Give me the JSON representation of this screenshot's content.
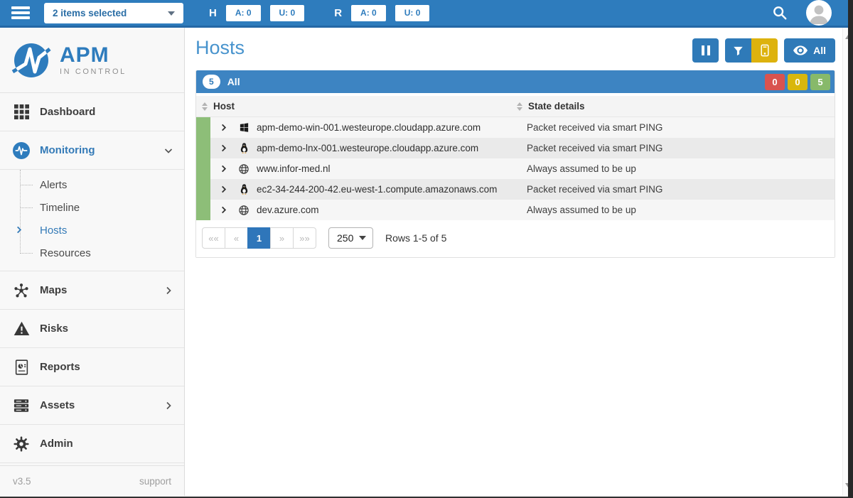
{
  "colors": {
    "topbar_blue": "#2e7cbd",
    "accent_blue": "#2f7ab8",
    "title_blue": "#4793cd",
    "filter_bar_blue": "#3d84c2",
    "yellow": "#ddb20e",
    "active_link": "#337ab7",
    "row_status_green": "#8dbe78"
  },
  "topbar": {
    "selected_filter": "2 items selected",
    "hosts_group": {
      "label": "H",
      "buttons": [
        {
          "label": "A: 0"
        },
        {
          "label": "U: 0"
        }
      ]
    },
    "resources_group": {
      "label": "R",
      "buttons": [
        {
          "label": "A: 0"
        },
        {
          "label": "U: 0"
        }
      ]
    }
  },
  "sidebar": {
    "logo": {
      "title": "APM",
      "subtitle": "IN CONTROL"
    },
    "items": [
      {
        "label": "Dashboard",
        "icon": "grid"
      },
      {
        "label": "Monitoring",
        "icon": "pulse",
        "active": true,
        "expanded": true,
        "children": [
          {
            "label": "Alerts"
          },
          {
            "label": "Timeline"
          },
          {
            "label": "Hosts",
            "active": true
          },
          {
            "label": "Resources"
          }
        ]
      },
      {
        "label": "Maps",
        "icon": "network",
        "has_children": true
      },
      {
        "label": "Risks",
        "icon": "warning"
      },
      {
        "label": "Reports",
        "icon": "report"
      },
      {
        "label": "Assets",
        "icon": "servers",
        "has_children": true
      },
      {
        "label": "Admin",
        "icon": "gear"
      }
    ],
    "footer": {
      "version": "v3.5",
      "support_label": "support"
    }
  },
  "main": {
    "title": "Hosts",
    "toolbar": {
      "eye_button_label": "All"
    },
    "filter_bar": {
      "count": "5",
      "label": "All",
      "badges": [
        {
          "value": "0",
          "color": "#d9534f"
        },
        {
          "value": "0",
          "color": "#d9b70d"
        },
        {
          "value": "5",
          "color": "#87b96a"
        }
      ]
    },
    "table": {
      "columns": [
        "Host",
        "State details"
      ],
      "rows": [
        {
          "os": "windows",
          "host": "apm-demo-win-001.westeurope.cloudapp.azure.com",
          "state": "Packet received via smart PING"
        },
        {
          "os": "linux",
          "host": "apm-demo-lnx-001.westeurope.cloudapp.azure.com",
          "state": "Packet received via smart PING"
        },
        {
          "os": "globe",
          "host": "www.infor-med.nl",
          "state": "Always assumed to be up"
        },
        {
          "os": "linux",
          "host": "ec2-34-244-200-42.eu-west-1.compute.amazonaws.com",
          "state": "Packet received via smart PING"
        },
        {
          "os": "globe",
          "host": "dev.azure.com",
          "state": "Always assumed to be up"
        }
      ]
    },
    "pagination": {
      "buttons": [
        {
          "label": "««",
          "disabled": true
        },
        {
          "label": "«",
          "disabled": true
        },
        {
          "label": "1",
          "active": true
        },
        {
          "label": "»",
          "disabled": true
        },
        {
          "label": "»»",
          "disabled": true
        }
      ],
      "page_size": "250",
      "info": "Rows 1-5 of 5"
    }
  }
}
